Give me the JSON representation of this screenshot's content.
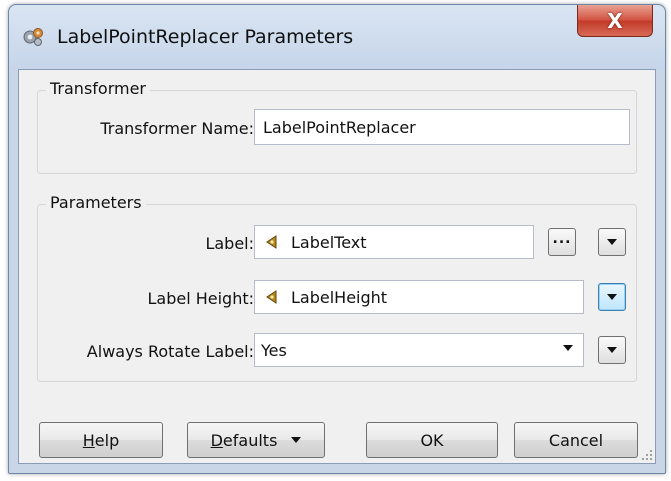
{
  "window": {
    "title": "LabelPointReplacer Parameters",
    "close_icon": "close-icon",
    "close_glyph": "X"
  },
  "transformer_group": {
    "legend": "Transformer",
    "name_label": "Transformer Name:",
    "name_value": "LabelPointReplacer"
  },
  "parameters_group": {
    "legend": "Parameters",
    "label": {
      "label": "Label:",
      "value": "LabelText",
      "ellipsis": "...",
      "icon": "attribute-icon"
    },
    "label_height": {
      "label": "Label Height:",
      "value": "LabelHeight",
      "icon": "attribute-icon"
    },
    "always_rotate": {
      "label": "Always Rotate Label:",
      "value": "Yes"
    }
  },
  "buttons": {
    "help_underline": "H",
    "help_rest": "elp",
    "defaults_underline": "D",
    "defaults_rest": "efaults",
    "ok": "OK",
    "cancel": "Cancel"
  },
  "colors": {
    "close_button": "#c13a28",
    "dialog_background": "#f0f0f0",
    "title_bar": "#c6d5e9"
  }
}
